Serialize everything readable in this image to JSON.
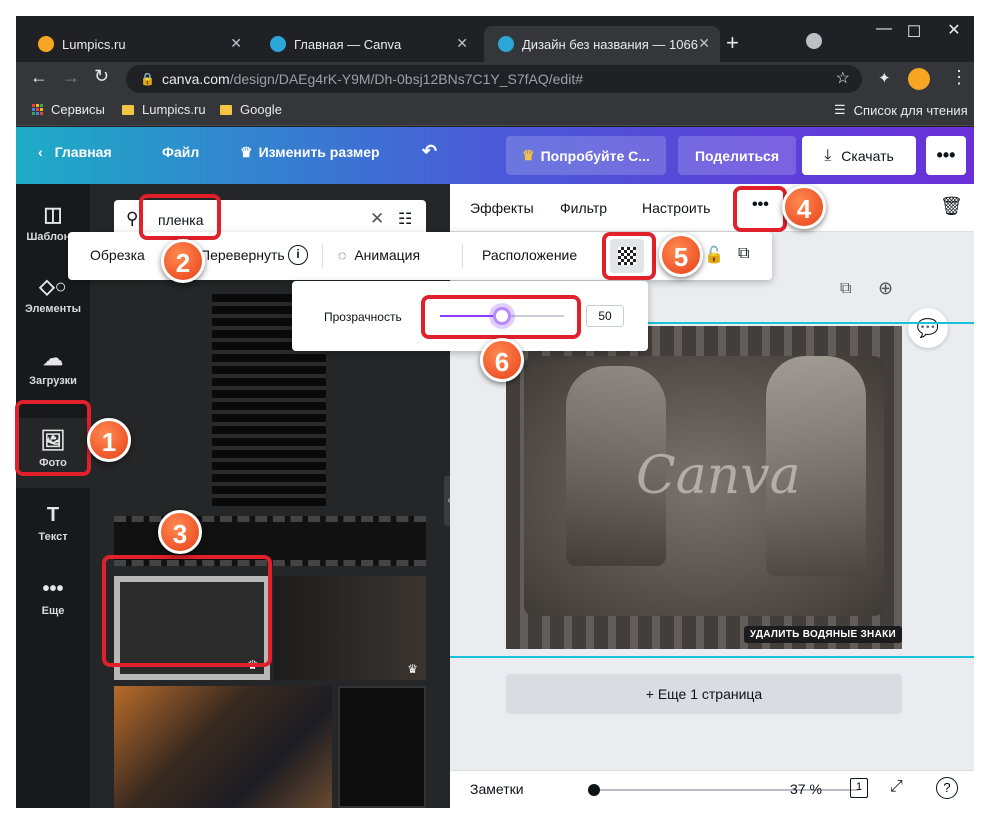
{
  "tabs": [
    {
      "title": "Lumpics.ru"
    },
    {
      "title": "Главная — Canva"
    },
    {
      "title": "Дизайн без названия — 1066"
    }
  ],
  "address": {
    "url_host": "canva.com",
    "url_path": "/design/DAEg4rK-Y9M/Dh-0bsj12BNs7C1Y_S7fAQ/edit#"
  },
  "bookmarks": {
    "services": "Сервисы",
    "lumpics": "Lumpics.ru",
    "google": "Google",
    "reading_list": "Список для чтения"
  },
  "topbar": {
    "home": "Главная",
    "file": "Файл",
    "resize": "Изменить размер",
    "try": "Попробуйте С...",
    "share": "Поделиться",
    "download": "Скачать"
  },
  "rail": {
    "templates": "Шаблоны",
    "elements": "Элементы",
    "uploads": "Загрузки",
    "photos": "Фото",
    "text": "Текст",
    "more": "Еще"
  },
  "search": {
    "value": "пленка"
  },
  "edit_toolbar": {
    "effects": "Эффекты",
    "filter": "Фильтр",
    "adjust": "Настроить"
  },
  "image_toolbar": {
    "crop": "Обрезка",
    "flip": "Перевернуть",
    "animation": "Анимация",
    "position": "Расположение"
  },
  "transparency": {
    "label": "Прозрачность",
    "value": "50",
    "level": 0.5
  },
  "canvas": {
    "watermark_text": "Canva",
    "remove_watermarks": "УДАЛИТЬ ВОДЯНЫЕ ЗНАКИ",
    "add_page": "+ Еще 1 страница"
  },
  "footer": {
    "notes": "Заметки",
    "zoom": "37 %",
    "page_count": "1"
  },
  "badges": [
    "1",
    "2",
    "3",
    "4",
    "5",
    "6"
  ],
  "colors": {
    "highlight": "#e0202a",
    "badge": "#e8401a",
    "accent": "#8b3dff"
  }
}
